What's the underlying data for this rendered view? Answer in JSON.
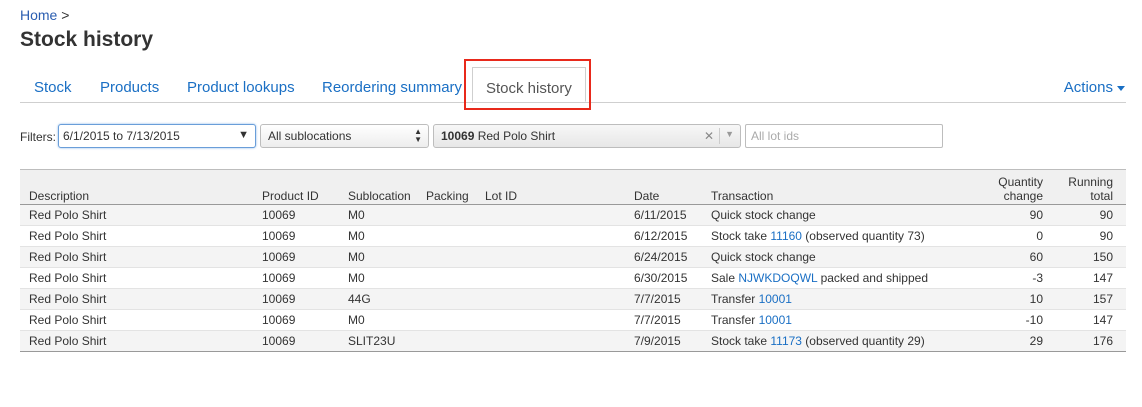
{
  "breadcrumb": {
    "home": "Home",
    "separator": ">"
  },
  "page_title": "Stock history",
  "tabs": [
    {
      "label": "Stock"
    },
    {
      "label": "Products"
    },
    {
      "label": "Product lookups"
    },
    {
      "label": "Reordering summary"
    },
    {
      "label": "Stock history"
    }
  ],
  "actions_label": "Actions",
  "colors": {
    "link": "#1a6fc4",
    "highlight": "#e8291b"
  },
  "filters": {
    "label": "Filters:",
    "date_range": "6/1/2015 to 7/13/2015",
    "sublocation": "All sublocations",
    "product_code": "10069",
    "product_name": "Red Polo Shirt",
    "lot_placeholder": "All lot ids"
  },
  "table": {
    "headers": {
      "description": "Description",
      "product_id": "Product ID",
      "sublocation": "Sublocation",
      "packing": "Packing",
      "lot_id": "Lot ID",
      "date": "Date",
      "transaction": "Transaction",
      "quantity_change_1": "Quantity",
      "quantity_change_2": "change",
      "running_total_1": "Running",
      "running_total_2": "total"
    },
    "rows": [
      {
        "description": "Red Polo Shirt",
        "product_id": "10069",
        "sublocation": "M0",
        "packing": "",
        "lot_id": "",
        "date": "6/11/2015",
        "trans_pre": "Quick stock change",
        "trans_link": "",
        "trans_post": "",
        "qty": "90",
        "total": "90"
      },
      {
        "description": "Red Polo Shirt",
        "product_id": "10069",
        "sublocation": "M0",
        "packing": "",
        "lot_id": "",
        "date": "6/12/2015",
        "trans_pre": "Stock take ",
        "trans_link": "11160",
        "trans_post": " (observed quantity 73)",
        "qty": "0",
        "total": "90"
      },
      {
        "description": "Red Polo Shirt",
        "product_id": "10069",
        "sublocation": "M0",
        "packing": "",
        "lot_id": "",
        "date": "6/24/2015",
        "trans_pre": "Quick stock change",
        "trans_link": "",
        "trans_post": "",
        "qty": "60",
        "total": "150"
      },
      {
        "description": "Red Polo Shirt",
        "product_id": "10069",
        "sublocation": "M0",
        "packing": "",
        "lot_id": "",
        "date": "6/30/2015",
        "trans_pre": "Sale ",
        "trans_link": "NJWKDOQWL",
        "trans_post": " packed and shipped",
        "qty": "-3",
        "total": "147"
      },
      {
        "description": "Red Polo Shirt",
        "product_id": "10069",
        "sublocation": "44G",
        "packing": "",
        "lot_id": "",
        "date": "7/7/2015",
        "trans_pre": "Transfer ",
        "trans_link": "10001",
        "trans_post": "",
        "qty": "10",
        "total": "157"
      },
      {
        "description": "Red Polo Shirt",
        "product_id": "10069",
        "sublocation": "M0",
        "packing": "",
        "lot_id": "",
        "date": "7/7/2015",
        "trans_pre": "Transfer ",
        "trans_link": "10001",
        "trans_post": "",
        "qty": "-10",
        "total": "147"
      },
      {
        "description": "Red Polo Shirt",
        "product_id": "10069",
        "sublocation": "SLIT23U",
        "packing": "",
        "lot_id": "",
        "date": "7/9/2015",
        "trans_pre": "Stock take ",
        "trans_link": "11173",
        "trans_post": " (observed quantity 29)",
        "qty": "29",
        "total": "176"
      }
    ]
  }
}
